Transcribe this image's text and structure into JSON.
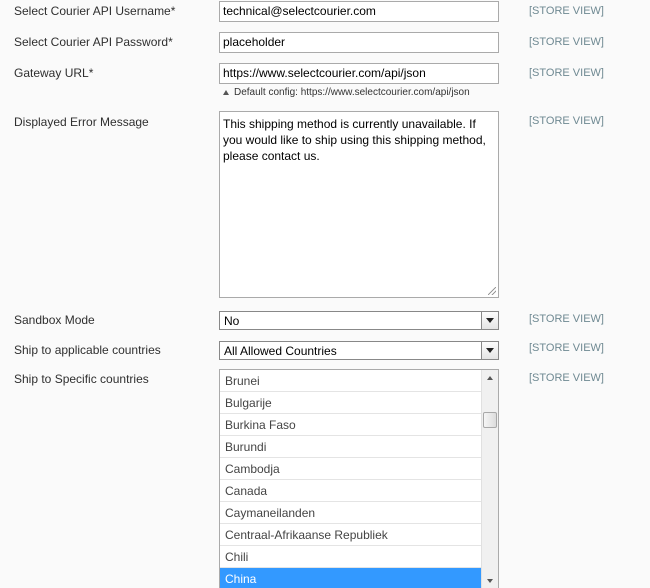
{
  "fields": {
    "username": {
      "label": "Select Courier API Username*",
      "value": "technical@selectcourier.com",
      "scope": "[STORE VIEW]"
    },
    "password": {
      "label": "Select Courier API Password*",
      "value": "placeholder",
      "scope": "[STORE VIEW]"
    },
    "gateway_url": {
      "label": "Gateway URL*",
      "value": "https://www.selectcourier.com/api/json",
      "note": "Default config: https://www.selectcourier.com/api/json",
      "scope": "[STORE VIEW]"
    },
    "error_message": {
      "label": "Displayed Error Message",
      "value": "This shipping method is currently unavailable. If you would like to ship using this shipping method, please contact us.",
      "scope": "[STORE VIEW]"
    },
    "sandbox_mode": {
      "label": "Sandbox Mode",
      "value": "No",
      "scope": "[STORE VIEW]"
    },
    "applicable_countries": {
      "label": "Ship to applicable countries",
      "value": "All Allowed Countries",
      "scope": "[STORE VIEW]"
    },
    "specific_countries": {
      "label": "Ship to Specific countries",
      "scope": "[STORE VIEW]",
      "options": [
        "Brunei",
        "Bulgarije",
        "Burkina Faso",
        "Burundi",
        "Cambodja",
        "Canada",
        "Caymaneilanden",
        "Centraal-Afrikaanse Republiek",
        "Chili",
        "China"
      ],
      "selected": "China"
    }
  },
  "colors": {
    "selected_bg": "#3399ff",
    "scope_text": "#6f8992"
  }
}
